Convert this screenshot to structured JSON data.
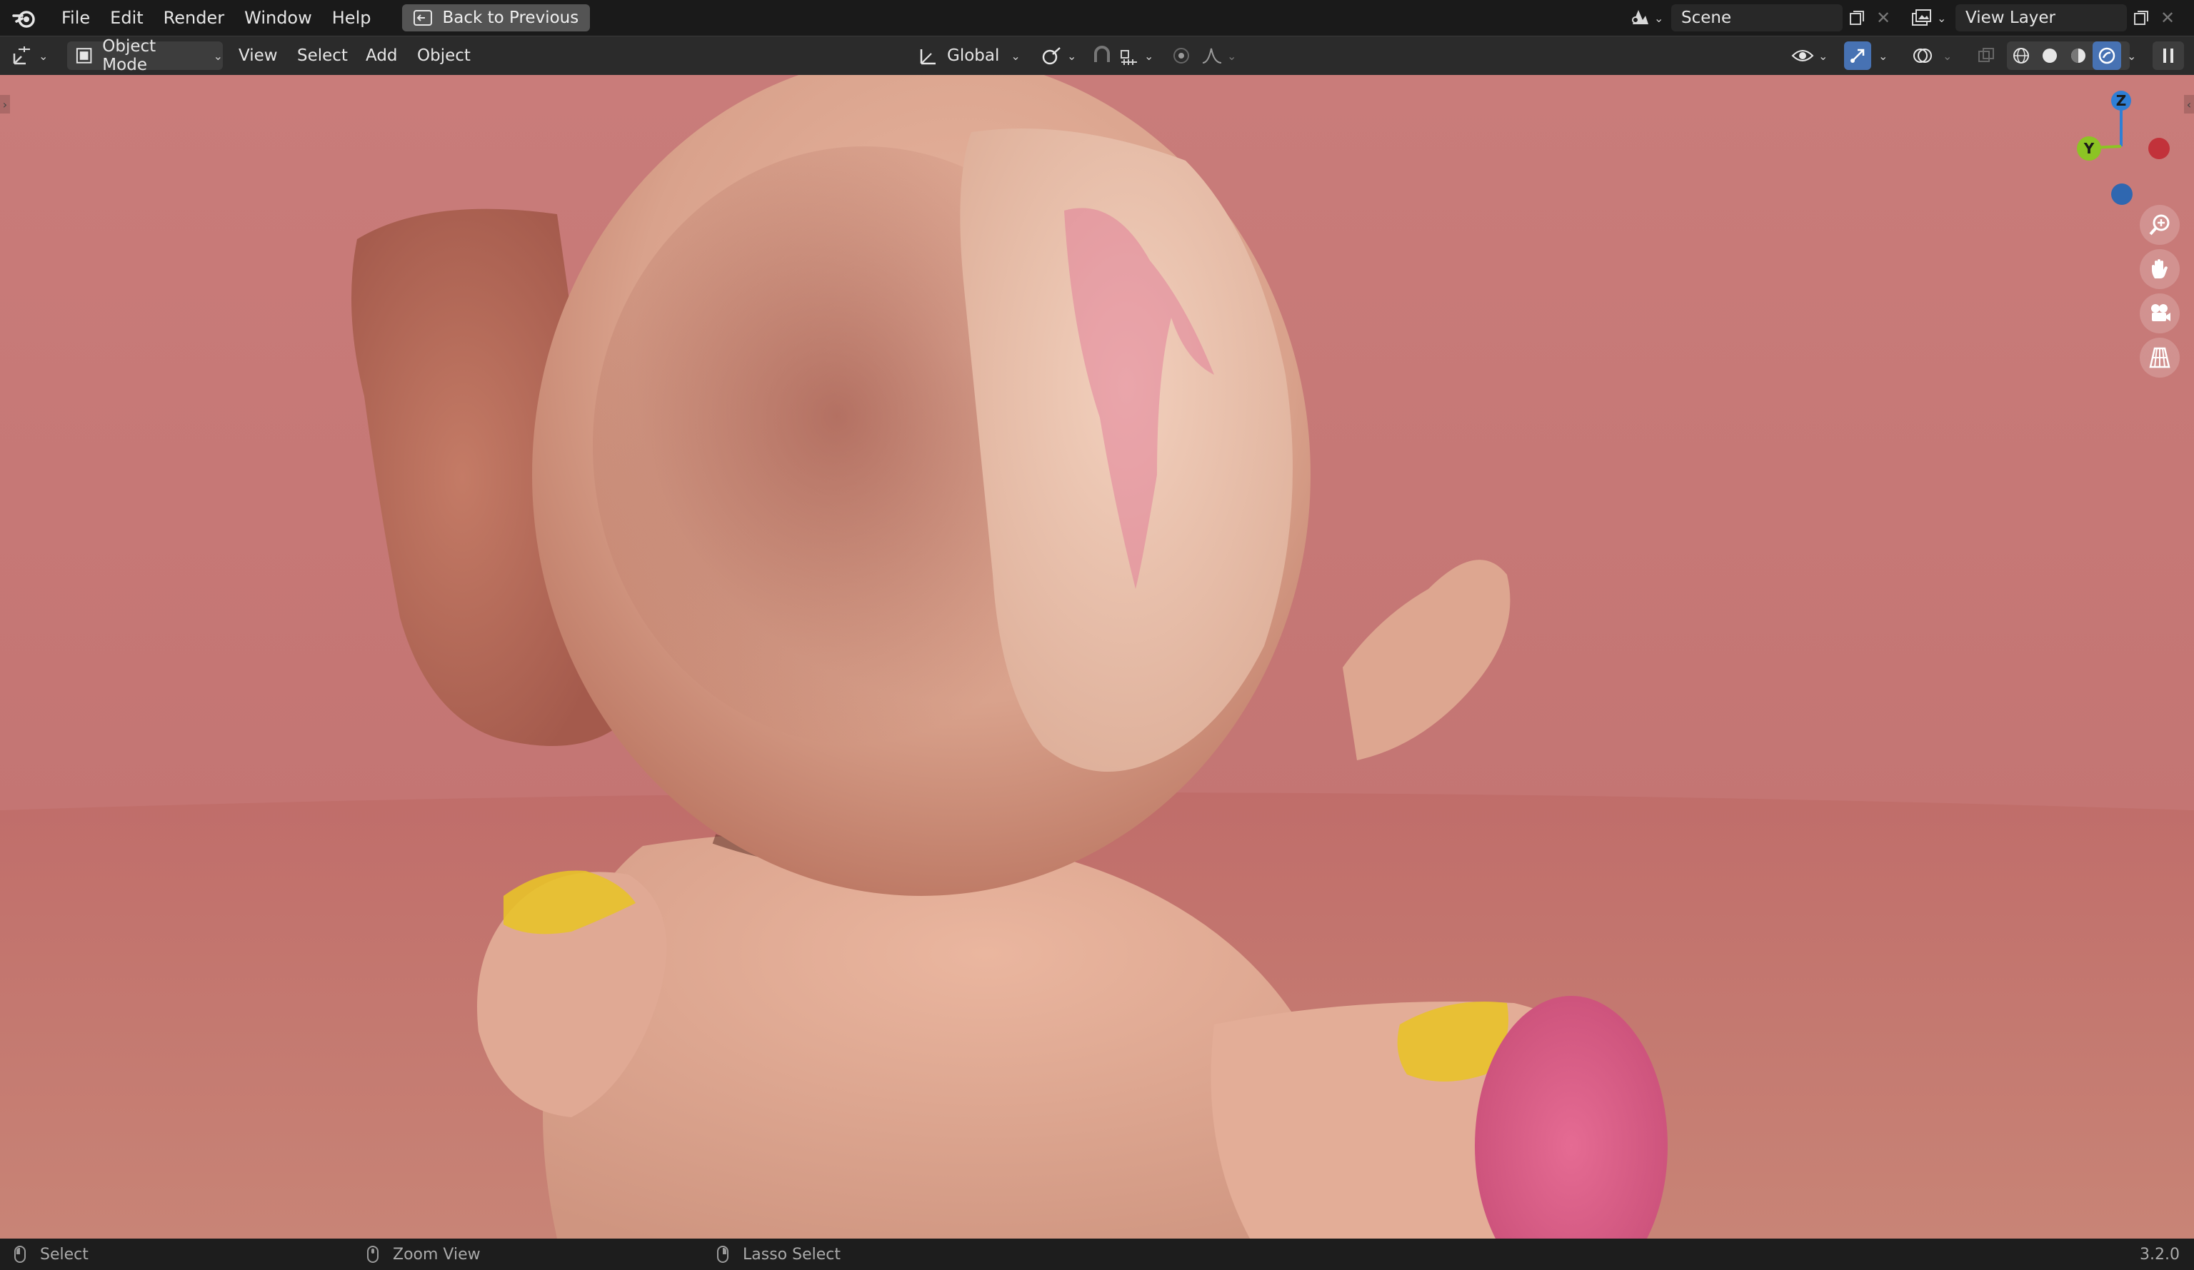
{
  "topbar": {
    "menus": [
      "File",
      "Edit",
      "Render",
      "Window",
      "Help"
    ],
    "back_button": "Back to Previous",
    "scene_name": "Scene",
    "view_layer_name": "View Layer"
  },
  "header": {
    "mode": "Object Mode",
    "menus": [
      "View",
      "Select",
      "Add",
      "Object"
    ],
    "transform_orientation": "Global"
  },
  "gizmo": {
    "z_label": "Z",
    "y_label": "Y"
  },
  "statusbar": {
    "left_action": "Select",
    "middle_action": "Zoom View",
    "right_action": "Lasso Select",
    "version": "3.2.0"
  },
  "colors": {
    "background_wall": "#c47a78",
    "floor": "#bf6f6c",
    "body": "#e2ab97",
    "foot_pad": "#e0628a",
    "patch": "#e8c22a",
    "accent_blue": "#4772b3",
    "gizmo_x": "#c2323a",
    "gizmo_y": "#8cc424",
    "gizmo_z": "#2f7fd6"
  }
}
